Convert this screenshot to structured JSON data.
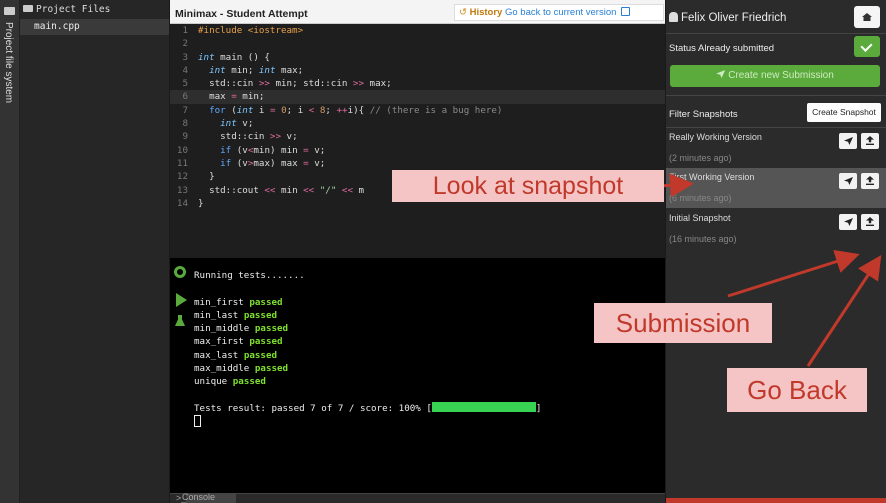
{
  "sidebar": {
    "label": "Project file system"
  },
  "filetree": {
    "title": "Project Files",
    "files": [
      "main.cpp"
    ]
  },
  "editor": {
    "title": "Minimax - Student Attempt",
    "history_label": "History",
    "history_link": "Go back to current version",
    "active_line": 6,
    "lines": [
      {
        "n": "1",
        "t": [
          [
            "pp",
            "#include <iostream>"
          ]
        ]
      },
      {
        "n": "2",
        "t": []
      },
      {
        "n": "3",
        "t": [
          [
            "ty",
            "int"
          ],
          [
            "txt",
            " main () {"
          ]
        ]
      },
      {
        "n": "4",
        "t": [
          [
            "txt",
            "  "
          ],
          [
            "ty",
            "int"
          ],
          [
            "txt",
            " min; "
          ],
          [
            "ty",
            "int"
          ],
          [
            "txt",
            " max;"
          ]
        ]
      },
      {
        "n": "5",
        "t": [
          [
            "txt",
            "  std::cin "
          ],
          [
            "op",
            ">>"
          ],
          [
            "txt",
            " min; std::cin "
          ],
          [
            "op",
            ">>"
          ],
          [
            "txt",
            " max;"
          ]
        ]
      },
      {
        "n": "6",
        "t": [
          [
            "txt",
            "  max "
          ],
          [
            "op",
            "="
          ],
          [
            "txt",
            " min;"
          ]
        ]
      },
      {
        "n": "7",
        "t": [
          [
            "txt",
            "  "
          ],
          [
            "kw",
            "for"
          ],
          [
            "txt",
            " ("
          ],
          [
            "ty",
            "int"
          ],
          [
            "txt",
            " i "
          ],
          [
            "op",
            "="
          ],
          [
            "txt",
            " "
          ],
          [
            "nm",
            "0"
          ],
          [
            "txt",
            "; i "
          ],
          [
            "op",
            "<"
          ],
          [
            "txt",
            " "
          ],
          [
            "nm",
            "8"
          ],
          [
            "txt",
            "; "
          ],
          [
            "op",
            "++"
          ],
          [
            "txt",
            "i){ "
          ],
          [
            "cm",
            "// (there is a bug here)"
          ]
        ]
      },
      {
        "n": "8",
        "t": [
          [
            "txt",
            "    "
          ],
          [
            "ty",
            "int"
          ],
          [
            "txt",
            " v;"
          ]
        ]
      },
      {
        "n": "9",
        "t": [
          [
            "txt",
            "    std::cin "
          ],
          [
            "op",
            ">>"
          ],
          [
            "txt",
            " v;"
          ]
        ]
      },
      {
        "n": "10",
        "t": [
          [
            "txt",
            "    "
          ],
          [
            "kw",
            "if"
          ],
          [
            "txt",
            " (v"
          ],
          [
            "op",
            "<"
          ],
          [
            "txt",
            "min) min "
          ],
          [
            "op",
            "="
          ],
          [
            "txt",
            " v;"
          ]
        ]
      },
      {
        "n": "11",
        "t": [
          [
            "txt",
            "    "
          ],
          [
            "kw",
            "if"
          ],
          [
            "txt",
            " (v"
          ],
          [
            "op",
            ">"
          ],
          [
            "txt",
            "max) max "
          ],
          [
            "op",
            "="
          ],
          [
            "txt",
            " v;"
          ]
        ]
      },
      {
        "n": "12",
        "t": [
          [
            "txt",
            "  }"
          ]
        ]
      },
      {
        "n": "13",
        "t": [
          [
            "txt",
            "  std::cout "
          ],
          [
            "op",
            "<<"
          ],
          [
            "txt",
            " min "
          ],
          [
            "op",
            "<<"
          ],
          [
            "txt",
            " "
          ],
          [
            "st",
            "\"/\""
          ],
          [
            "txt",
            " "
          ],
          [
            "op",
            "<<"
          ],
          [
            "txt",
            " m"
          ]
        ]
      },
      {
        "n": "14",
        "t": [
          [
            "txt",
            "}"
          ]
        ]
      }
    ]
  },
  "console": {
    "running": "Running tests.......",
    "tests": [
      {
        "name": "min_first",
        "status": "passed"
      },
      {
        "name": "min_last",
        "status": "passed"
      },
      {
        "name": "min_middle",
        "status": "passed"
      },
      {
        "name": "max_first",
        "status": "passed"
      },
      {
        "name": "max_last",
        "status": "passed"
      },
      {
        "name": "max_middle",
        "status": "passed"
      },
      {
        "name": "unique",
        "status": "passed"
      }
    ],
    "result": "Tests result: passed 7 of 7 / score: 100% [",
    "result_end": "]",
    "progress": 1.0,
    "tab_label": "Console"
  },
  "panel": {
    "user": "Felix Oliver Friedrich",
    "status": "Status Already submitted",
    "new_submission": "Create new Submission",
    "filter_label": "Filter Snapshots",
    "create_snapshot": "Create Snapshot",
    "snapshots": [
      {
        "name": "Really Working Version",
        "time": "(2 minutes ago)"
      },
      {
        "name": "First Working Version",
        "time": "(6 minutes ago)"
      },
      {
        "name": "Initial Snapshot",
        "time": "(16 minutes ago)"
      }
    ]
  },
  "annotations": {
    "look": "Look at snapshot",
    "submission": "Submission",
    "goback": "Go Back"
  },
  "colors": {
    "accent_green": "#5aab3c",
    "annotation_red": "#c0392b",
    "annotation_bg": "#f5c5c5"
  }
}
